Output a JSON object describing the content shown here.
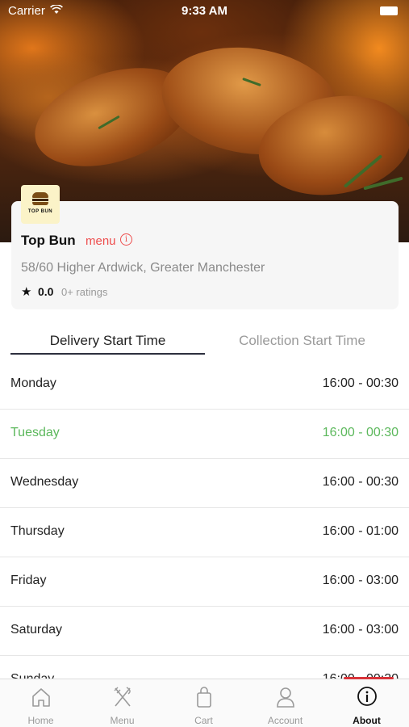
{
  "status_bar": {
    "carrier": "Carrier",
    "time": "9:33 AM"
  },
  "restaurant": {
    "logo_text": "TOP BUN",
    "name": "Top Bun",
    "menu_link": "menu",
    "info_icon": "info-circle-icon",
    "address": "58/60 Higher Ardwick, Greater Manchester",
    "rating": "0.0",
    "rating_count": "0+ ratings"
  },
  "tabs": [
    {
      "label": "Delivery Start Time",
      "active": true
    },
    {
      "label": "Collection Start Time",
      "active": false
    }
  ],
  "schedule": [
    {
      "day": "Monday",
      "hours": "16:00 - 00:30"
    },
    {
      "day": "Tuesday",
      "hours": "16:00 - 00:30",
      "today": true
    },
    {
      "day": "Wednesday",
      "hours": "16:00 - 00:30"
    },
    {
      "day": "Thursday",
      "hours": "16:00 - 01:00"
    },
    {
      "day": "Friday",
      "hours": "16:00 - 03:00"
    },
    {
      "day": "Saturday",
      "hours": "16:00 - 03:00"
    },
    {
      "day": "Sunday",
      "hours": "16:00 - 00:30"
    }
  ],
  "colors": {
    "accent": "#ee4d4d",
    "today": "#5cb85c",
    "tab_underline": "#2d2f3e"
  },
  "tabbar": [
    {
      "label": "Home",
      "icon": "home-icon"
    },
    {
      "label": "Menu",
      "icon": "fork-knife-icon"
    },
    {
      "label": "Cart",
      "icon": "shopping-bag-icon"
    },
    {
      "label": "Account",
      "icon": "user-icon"
    },
    {
      "label": "About",
      "icon": "info-icon",
      "active": true
    }
  ]
}
